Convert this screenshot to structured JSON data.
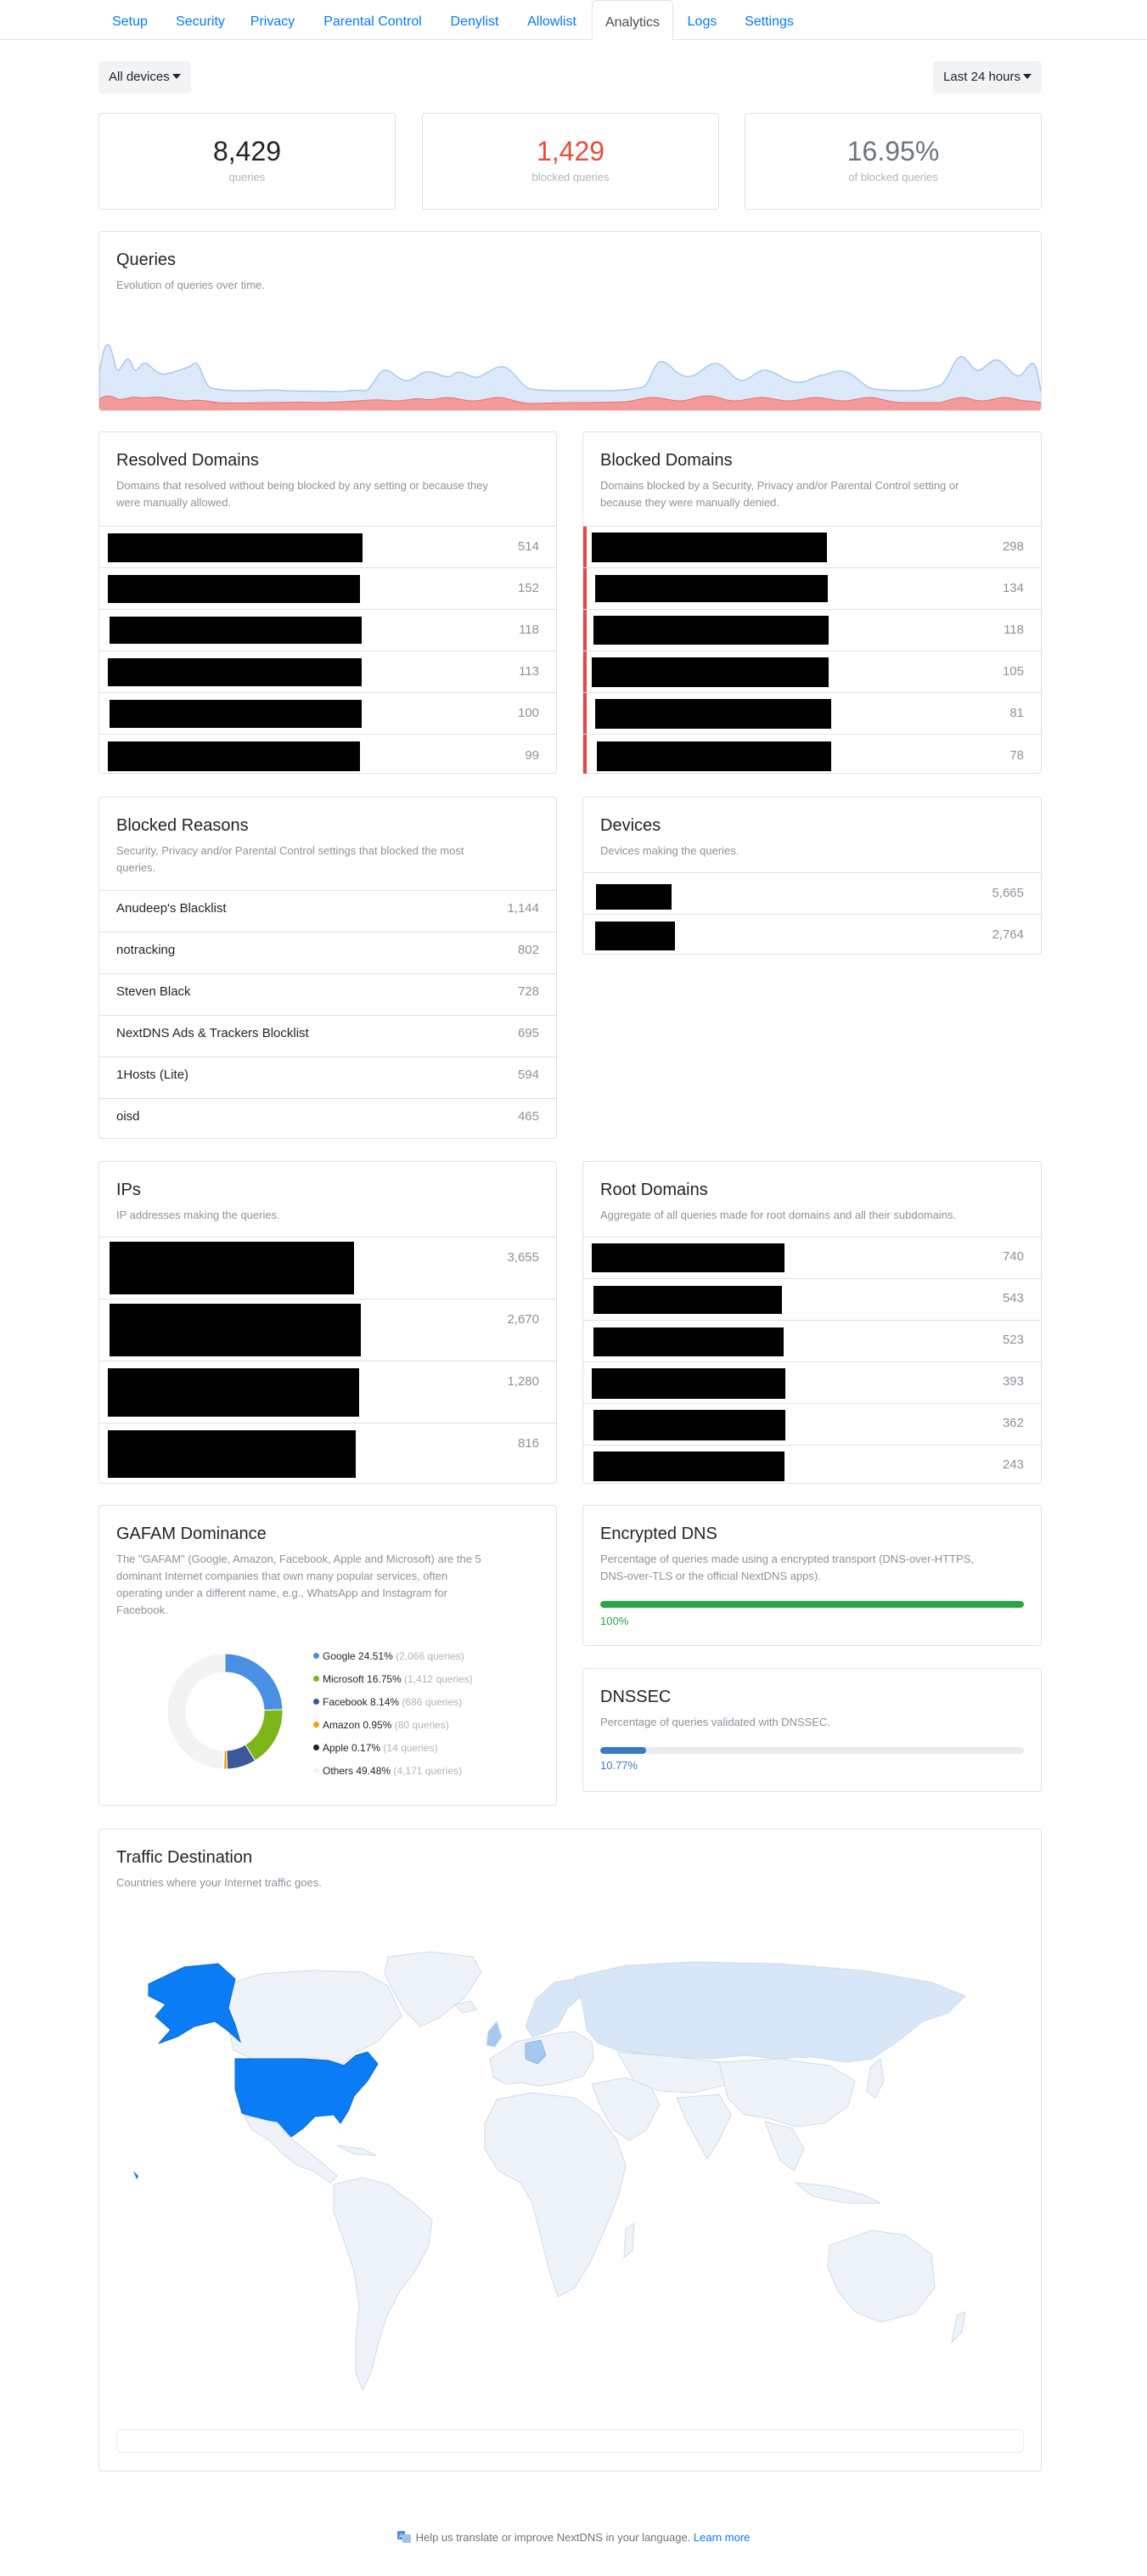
{
  "nav": {
    "tabs": [
      {
        "label": "Setup"
      },
      {
        "label": "Security"
      },
      {
        "label": "Privacy"
      },
      {
        "label": "Parental Control"
      },
      {
        "label": "Denylist"
      },
      {
        "label": "Allowlist"
      },
      {
        "label": "Analytics",
        "active": true
      },
      {
        "label": "Logs"
      },
      {
        "label": "Settings"
      }
    ]
  },
  "filters": {
    "device_label": "All devices",
    "range_label": "Last 24 hours"
  },
  "stats": [
    {
      "value": "8,429",
      "label": "queries",
      "color": "#212529"
    },
    {
      "value": "1,429",
      "label": "blocked queries",
      "color": "#e74c3c"
    },
    {
      "value": "16.95%",
      "label": "of blocked queries",
      "color": "#6c757d"
    }
  ],
  "queries": {
    "title": "Queries",
    "description": "Evolution of queries over time.",
    "colors": {
      "total": "#dbe9fb",
      "total_line": "#a9c9f0",
      "blocked": "#f49a9a",
      "blocked_line": "#e8706f"
    }
  },
  "resolved": {
    "title": "Resolved Domains",
    "description": [
      "Domains that resolved without being blocked by any setting or because they",
      "were manually allowed."
    ],
    "values": [
      "514",
      "152",
      "118",
      "113",
      "100",
      "99"
    ]
  },
  "blocked": {
    "title": "Blocked Domains",
    "description": [
      "Domains blocked by a Security, Privacy and/or Parental Control setting or",
      "because they were manually denied."
    ],
    "values": [
      "298",
      "134",
      "118",
      "105",
      "81",
      "78"
    ]
  },
  "reasons": {
    "title": "Blocked Reasons",
    "description": [
      "Security, Privacy and/or Parental Control settings that blocked the most",
      "queries."
    ],
    "rows": [
      {
        "label": "Anudeep's Blacklist",
        "value": "1,144"
      },
      {
        "label": "notracking",
        "value": "802"
      },
      {
        "label": "Steven Black",
        "value": "728"
      },
      {
        "label": "NextDNS Ads & Trackers Blocklist",
        "value": "695"
      },
      {
        "label": "1Hosts (Lite)",
        "value": "594"
      },
      {
        "label": "oisd",
        "value": "465"
      }
    ]
  },
  "devices": {
    "title": "Devices",
    "description": "Devices making the queries.",
    "values": [
      "5,665",
      "2,764"
    ]
  },
  "ips": {
    "title": "IPs",
    "description": "IP addresses making the queries.",
    "values": [
      "3,655",
      "2,670",
      "1,280",
      "816"
    ]
  },
  "roots": {
    "title": "Root Domains",
    "description": "Aggregate of all queries made for root domains and all their subdomains.",
    "values": [
      "740",
      "543",
      "523",
      "393",
      "362",
      "243"
    ]
  },
  "gafam": {
    "title": "GAFAM Dominance",
    "description": [
      "The \"GAFAM\" (Google, Amazon, Facebook, Apple and Microsoft) are the 5",
      "dominant Internet companies that own many popular services, often",
      "operating under a different name, e.g., WhatsApp and Instagram for",
      "Facebook."
    ],
    "chart_data": {
      "type": "pie",
      "categories": [
        "Google",
        "Microsoft",
        "Facebook",
        "Amazon",
        "Apple",
        "Others"
      ],
      "values": [
        24.51,
        16.75,
        8.14,
        0.95,
        0.17,
        49.48
      ]
    },
    "legend": [
      {
        "name": "Google",
        "pct": "24.51%",
        "count": "(2,066 queries)",
        "color": "#4a90e2"
      },
      {
        "name": "Microsoft",
        "pct": "16.75%",
        "count": "(1,412 queries)",
        "color": "#7cb518"
      },
      {
        "name": "Facebook",
        "pct": "8.14%",
        "count": "(686 queries)",
        "color": "#3b5998"
      },
      {
        "name": "Amazon",
        "pct": "0.95%",
        "count": "(80 queries)",
        "color": "#f0a30a"
      },
      {
        "name": "Apple",
        "pct": "0.17%",
        "count": "(14 queries)",
        "color": "#212529"
      },
      {
        "name": "Others",
        "pct": "49.48%",
        "count": "(4,171 queries)",
        "color": "#f1f3f5"
      }
    ]
  },
  "encrypted": {
    "title": "Encrypted DNS",
    "description": [
      "Percentage of queries made using a encrypted transport (DNS-over-HTTPS,",
      "DNS-over-TLS or the official NextDNS apps)."
    ],
    "percent": 100,
    "percent_label": "100%",
    "color": "#28a745"
  },
  "dnssec": {
    "title": "DNSSEC",
    "description": "Percentage of queries validated with DNSSEC.",
    "percent": 10.77,
    "percent_label": "10.77%",
    "color": "#3a7cc4"
  },
  "traffic": {
    "title": "Traffic Destination",
    "description": "Countries where your Internet traffic goes.",
    "colors": {
      "land": "#eef3f9",
      "border": "#cfdbe8",
      "highlight": "#0a7cf5",
      "light": "#d8e7f8",
      "medium": "#a6c8ef"
    }
  },
  "footer": {
    "text": "Help us translate or improve NextDNS in your language.",
    "link": "Learn more"
  }
}
